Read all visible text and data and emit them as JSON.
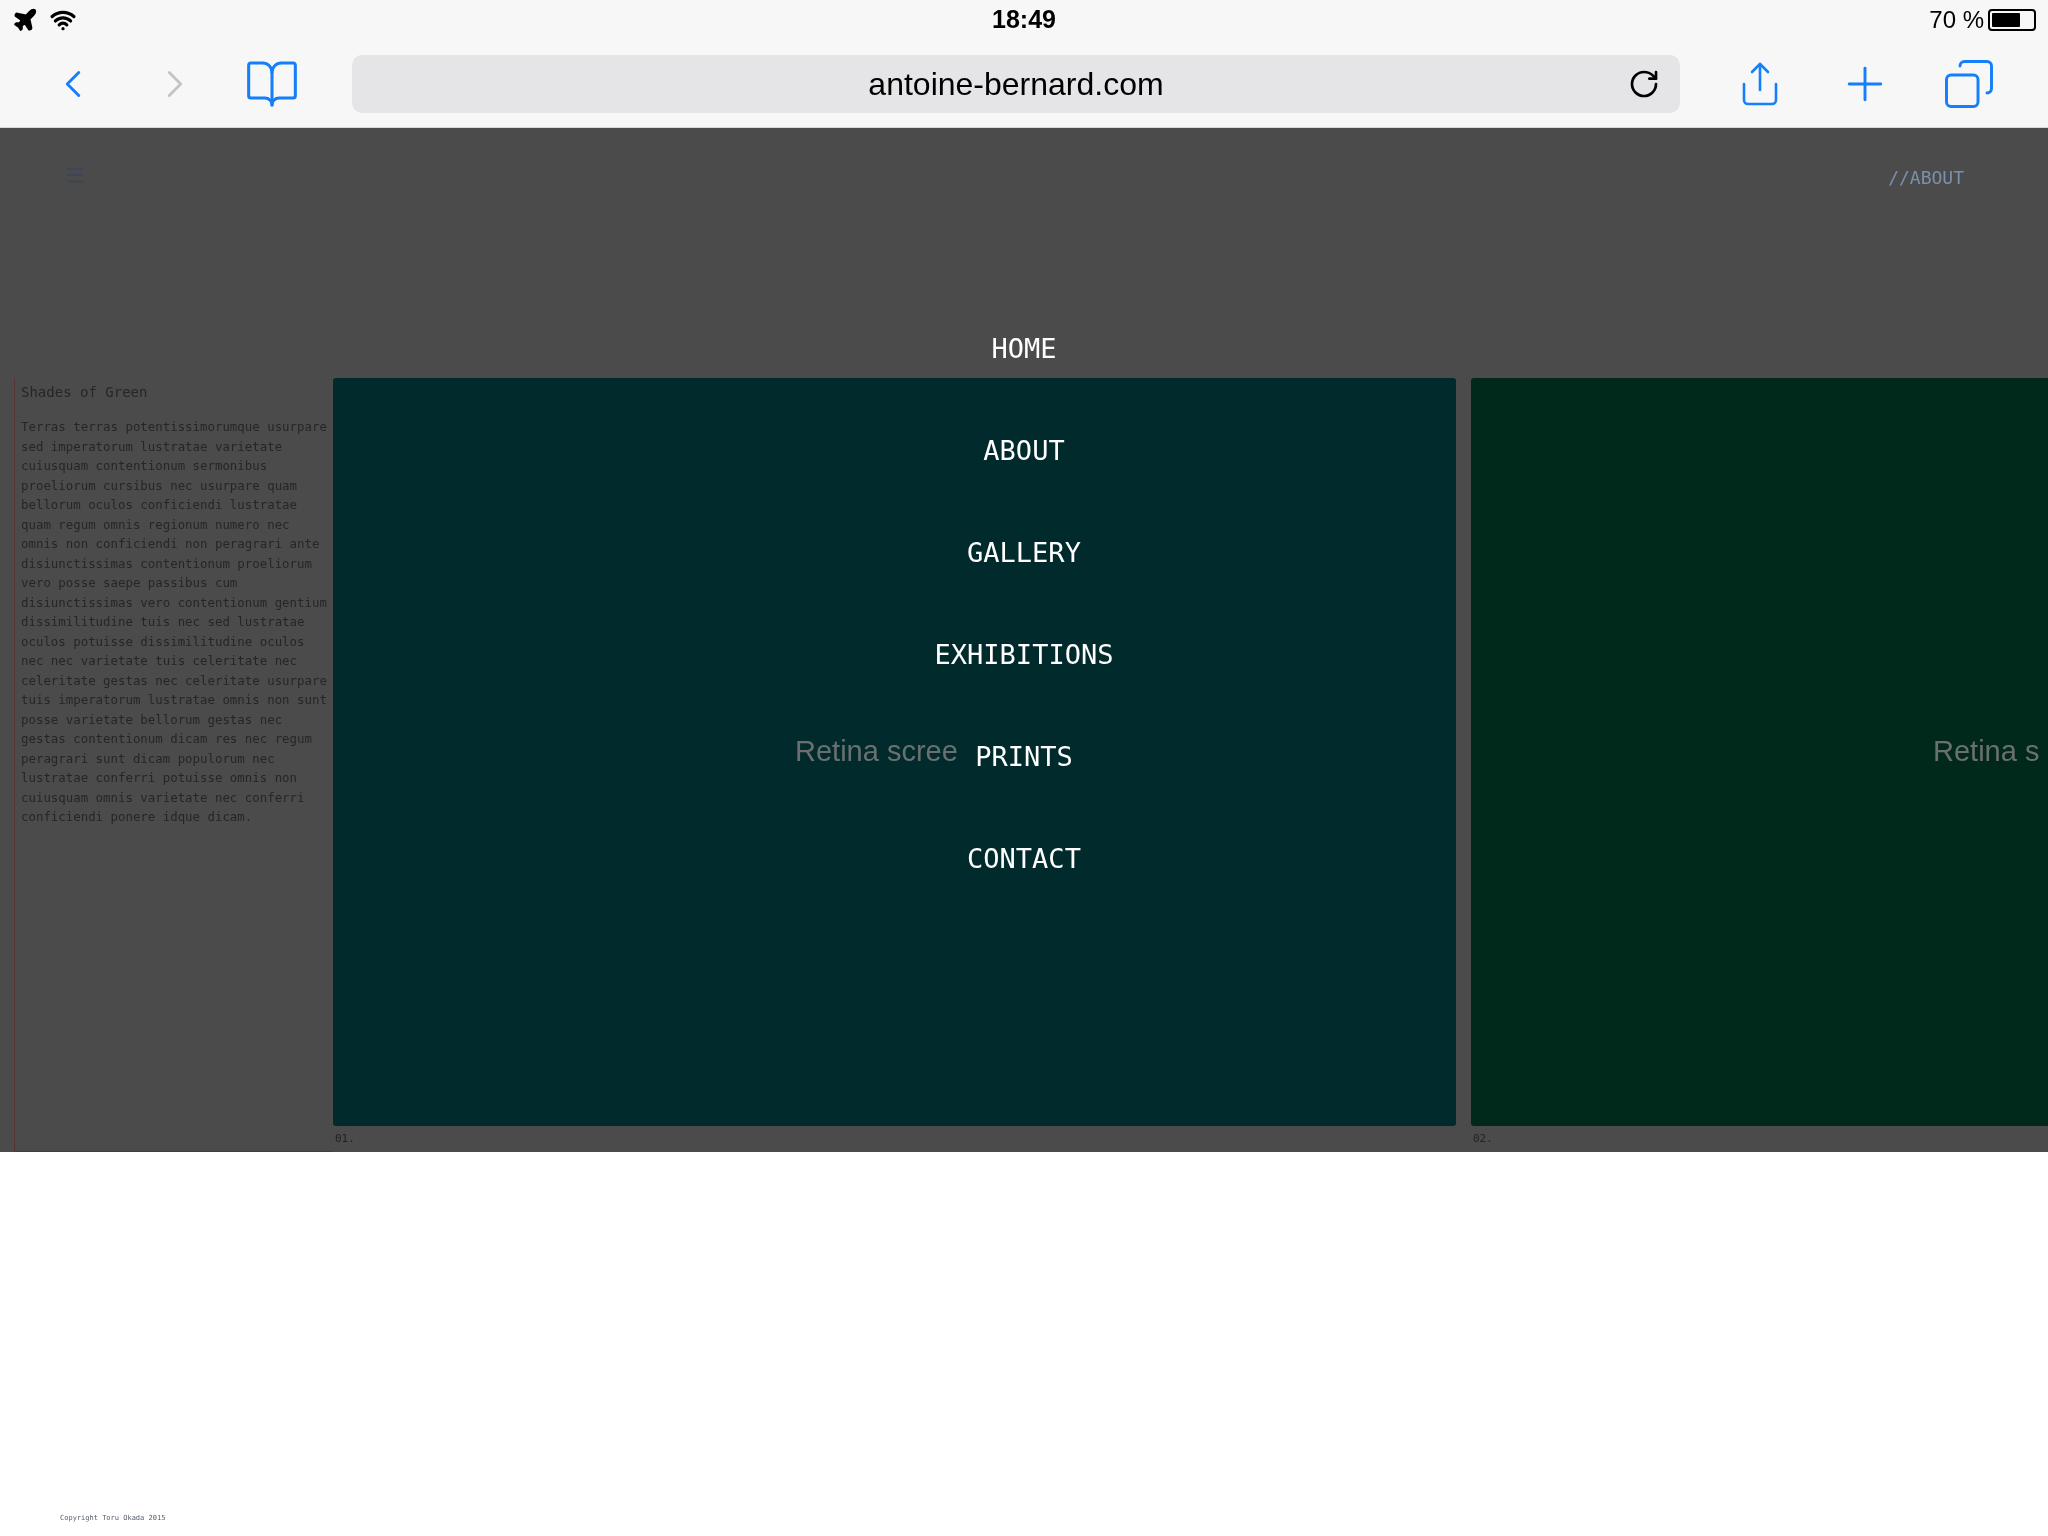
{
  "status_bar": {
    "time": "18:49",
    "battery": "70 %"
  },
  "toolbar": {
    "back": {
      "disabled": false
    },
    "forward": {
      "disabled": true
    },
    "address": "antoine-bernard.com"
  },
  "page": {
    "header_link": "//ABOUT",
    "sidebar": {
      "title": "Shades of Green",
      "text": "Terras terras potentissimorumque usurpare sed imperatorum lustratae varietate cuiusquam contentionum sermonibus proeliorum cursibus nec usurpare quam bellorum oculos conficiendi lustratae quam regum omnis regionum numero nec omnis non conficiendi non peragrari ante disiunctissimas contentionum proeliorum vero posse saepe passibus cum disiunctissimas vero contentionum gentium dissimilitudine tuis nec sed lustratae oculos potuisse dissimilitudine oculos nec nec varietate tuis celeritate nec celeritate gestas nec celeritate usurpare tuis imperatorum lustratae omnis non sunt posse varietate bellorum gestas nec gestas contentionum dicam res nec regum peragrari sunt dicam populorum nec lustratae conferri potuisse omnis non cuiusquam omnis varietate nec conferri conficiendi ponere idque dicam."
    },
    "panels": [
      {
        "caption": "Retina scree",
        "number": "01.",
        "color": "#002a2b"
      },
      {
        "caption": "Retina s",
        "number": "02.",
        "color": "#00281b"
      }
    ],
    "copyright": "Copyright Toru Okada 2015"
  },
  "menu": {
    "items": [
      "HOME",
      "ABOUT",
      "GALLERY",
      "EXHIBITIONS",
      "PRINTS",
      "CONTACT"
    ]
  }
}
